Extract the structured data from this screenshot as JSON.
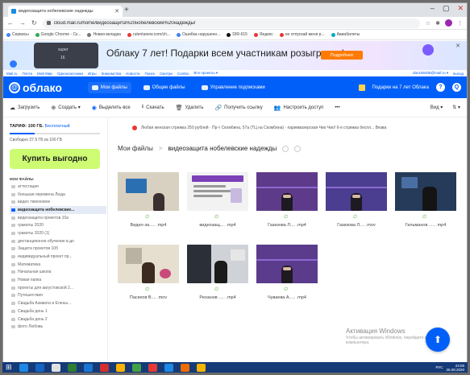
{
  "browser": {
    "tab_title": "видеозащита нобелевские надежды",
    "tab_close": "✕",
    "new_tab": "+",
    "url": "cloud.mail.ru/home/видеозащита%20нобелевские%20надежды/",
    "bookmarks": [
      {
        "label": "Сервисы",
        "color": "#4285f4"
      },
      {
        "label": "Google Chrome - Ск...",
        "color": "#34a853"
      },
      {
        "label": "Новая вкладка",
        "color": "#777777"
      },
      {
        "label": "rutentanew.com/ch...",
        "color": "#e53935"
      },
      {
        "label": "Ошибка нарушено...",
        "color": "#4285f4"
      },
      {
        "label": "DIR-615",
        "color": "#111111"
      },
      {
        "label": "Яндекс",
        "color": "#e53935"
      },
      {
        "label": "не отпускай меня р...",
        "color": "#e53935"
      },
      {
        "label": "Авиабилеты",
        "color": "#00acc1"
      }
    ]
  },
  "banner": {
    "text": "Облаку 7 лет! Подарки всем участникам розыгрыша!",
    "button": "Подробнее",
    "icon_line1": "super",
    "icon_line2": "16"
  },
  "portal": {
    "links": [
      "Mail.ru",
      "Почта",
      "Мой Мир",
      "Одноклассники",
      "Игры",
      "Знакомства",
      "Новости",
      "Поиск",
      "Смотри",
      "Combo",
      "Все проекты ▾"
    ],
    "user": "dan165408@mail.ru ▾",
    "exit": "выход"
  },
  "header": {
    "logo": "облако",
    "nav": [
      {
        "label": "Мои файлы",
        "active": true
      },
      {
        "label": "Общие файлы",
        "active": false
      },
      {
        "label": "Управление подписками",
        "active": false
      }
    ],
    "gift": "Подарки на 7 лет Облака",
    "help": "?",
    "user_initial": "Q"
  },
  "toolbar": {
    "upload": "Загрузить",
    "create": "Создать ▾",
    "select_all": "Выделить все",
    "download": "Скачать",
    "delete": "Удалить",
    "get_link": "Получить ссылку",
    "access": "Настроить доступ",
    "more": "•••",
    "view": "Вид ▾",
    "sort": "⇅ ▾"
  },
  "sidebar": {
    "tariff_label": "ТАРИФ: 100 ГБ.",
    "tariff_value": "Бесплатный",
    "quota_fraction": 0.28,
    "free_text": "Свободно 27.9 ГБ из 100 ГБ",
    "buy_button": "Купить выгодно",
    "my_files": "МОИ ФАЙЛЫ",
    "folders": [
      {
        "label": "аттестация",
        "active": false
      },
      {
        "label": "большая перемена Люда",
        "active": false
      },
      {
        "label": "видео тимоновое",
        "active": false
      },
      {
        "label": "видеозащита нобелевские...",
        "active": true
      },
      {
        "label": "видеозащита проектов 10а",
        "active": false
      },
      {
        "label": "грамоты 2020",
        "active": false
      },
      {
        "label": "грамоты 2020 (1)",
        "active": false
      },
      {
        "label": "дистанционное обучение в.до",
        "active": false
      },
      {
        "label": "Защита проектов 10б",
        "active": false
      },
      {
        "label": "индивидуальный проект пр...",
        "active": false
      },
      {
        "label": "Математика",
        "active": false
      },
      {
        "label": "Начальная школа",
        "active": false
      },
      {
        "label": "Новая папка",
        "active": false
      },
      {
        "label": "проекты для августовской 2...",
        "active": false
      },
      {
        "label": "Путешествия",
        "active": false
      },
      {
        "label": "Свадьба Азамата и Елены...",
        "active": false
      },
      {
        "label": "Свадьба день 1",
        "active": false
      },
      {
        "label": "Свадьба день 2",
        "active": false
      },
      {
        "label": "фото Любовь",
        "active": false
      }
    ]
  },
  "main": {
    "notice": "Любая женская стрижка 250 рублей · Пр-т Скомбина, 57а (ТЦ на Скомбина) · парикмахерская Чио Чио! 6-я стрижка беспл... Вязва",
    "breadcrumb_root": "Мои файлы",
    "breadcrumb_sep": ">",
    "breadcrumb_current": "видеозащита нобелевские надежды",
    "link_icon": "∅",
    "files": [
      {
        "name": "Видео-за..... .mp4",
        "wall": "#d8d0c0",
        "kind": "screen"
      },
      {
        "name": "видеозащ.... .mp4",
        "wall": "#f2f2f2",
        "kind": "slide"
      },
      {
        "name": "Газизова Л.... .mp4",
        "wall": "#5e3b8a",
        "kind": "purple"
      },
      {
        "name": "Газизова Л.... .mov",
        "wall": "#4b3d8f",
        "kind": "purple"
      },
      {
        "name": "Гильманов ..... .mp4",
        "wall": "#263b5a",
        "kind": "dark"
      },
      {
        "name": "Пасихов В.... .mov",
        "wall": "#e6dfd0",
        "kind": "room"
      },
      {
        "name": "Рюзанов ..... .mp4",
        "wall": "#cfd3d8",
        "kind": "dark2"
      },
      {
        "name": "Чуваева А..... .mp4",
        "wall": "#5b3b8c",
        "kind": "purple"
      }
    ]
  },
  "watermark": {
    "title": "Активация Windows",
    "subtitle": "Чтобы активировать Windows, перейдите в параметры компьютера."
  },
  "fab_icon": "⬆",
  "taskbar": {
    "lang": "РУС",
    "time": "23:05",
    "date": "26.08.2020",
    "apps": [
      "#1e88e5",
      "#1565c0",
      "#e0e0e0",
      "#2e7d32",
      "#1976d2",
      "#d32f2f",
      "#ffb300",
      "#43a047",
      "#e53935",
      "#1e88e5",
      "#ef6c00",
      "#f4b400"
    ]
  }
}
